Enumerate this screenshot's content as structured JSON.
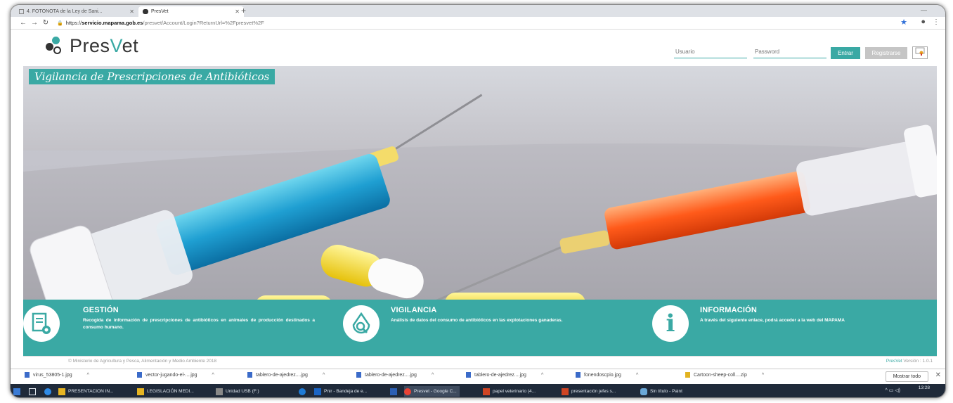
{
  "browser": {
    "tabs": [
      {
        "label": "4. FOTONOTA de la Ley de Sani..."
      },
      {
        "label": "PresVet"
      }
    ],
    "url": {
      "scheme": "https://",
      "domain": "servicio.mapama.gob.es",
      "path": "/presvet/Account/Login?ReturnUrl=%2Fpresvet%2F"
    }
  },
  "site": {
    "logo": {
      "pre": "Pres",
      "accent": "V",
      "post": "et"
    },
    "username_placeholder": "Usuario",
    "password_placeholder": "Password",
    "login_label": "Entrar",
    "register_label": "Registrarse",
    "hero_title": "Vigilancia de Prescripciones de Antibióticos",
    "features": [
      {
        "title": "GESTIÓN",
        "description": "Recogida de información de prescripciones de antibióticos en animales de producción destinados a consumo humano."
      },
      {
        "title": "VIGILANCIA",
        "description": "Análisis de datos del consumo de antibióticos en las explotaciones ganaderas."
      },
      {
        "title": "INFORMACIÓN",
        "description": "A través del siguiente enlace, podrá acceder a la web del MAPAMA"
      }
    ],
    "copyright": "© Ministerio de Agricultura y Pesca, Alimentación y Medio Ambiente 2018",
    "version": {
      "brand": "PresVet",
      "text": " Versión : 1.0.1"
    }
  },
  "downloads": {
    "items": [
      {
        "name": "virus_53805-1.jpg"
      },
      {
        "name": "vector-jugando-el-....jpg"
      },
      {
        "name": "tablero-de-ajedrez....jpg"
      },
      {
        "name": "tablero-de-ajedrez....jpg"
      },
      {
        "name": "tablero-de-ajedrez....jpg"
      },
      {
        "name": "fonendoscpio.jpg"
      },
      {
        "name": "Cartoon-sheep-coll....zip"
      }
    ],
    "show_all_label": "Mostrar todo"
  },
  "taskbar": {
    "items": [
      {
        "label": "PRESENTACION IN..."
      },
      {
        "label": "LEGISLACIÓN MEDI..."
      },
      {
        "label": "Unidad USB (F:)"
      },
      {
        "label": "Pnir - Bandeja de e..."
      },
      {
        "label": "Presvet - Google C..."
      },
      {
        "label": "papel veterinario (4..."
      },
      {
        "label": "presentación jefes s..."
      },
      {
        "label": "Sin título - Paint"
      }
    ],
    "time": "13:28"
  },
  "colors": {
    "accent": "#3aa9a4",
    "register": "#c5c5c5",
    "taskbar": "#1f2a3a"
  }
}
